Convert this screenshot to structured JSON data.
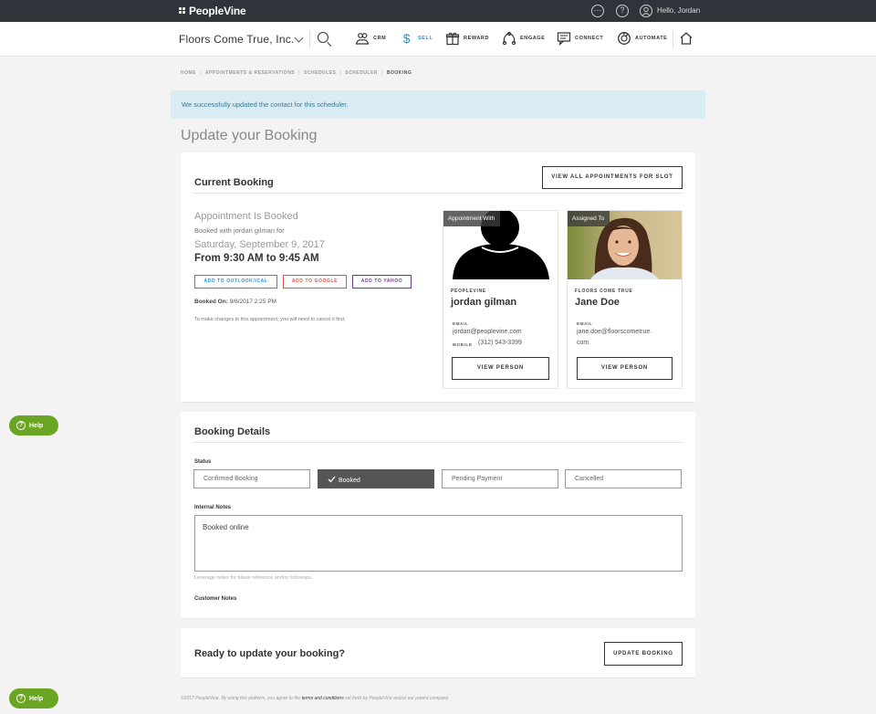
{
  "topbar": {
    "logo": "PeopleVine",
    "greeting": "Hello, Jordan",
    "icons": [
      "more-icon",
      "help-icon",
      "user-icon"
    ]
  },
  "nav": {
    "brand": "Floors Come True, Inc.",
    "items": [
      {
        "label": "CRM",
        "icon": "crm-icon"
      },
      {
        "label": "SELL",
        "icon": "dollar-icon",
        "active": true
      },
      {
        "label": "REWARD",
        "icon": "gift-icon"
      },
      {
        "label": "ENGAGE",
        "icon": "engage-icon"
      },
      {
        "label": "CONNECT",
        "icon": "chat-icon"
      },
      {
        "label": "AUTOMATE",
        "icon": "automate-icon"
      }
    ]
  },
  "breadcrumb": [
    "HOME",
    "APPOINTMENTS & RESERVATIONS",
    "SCHEDULES",
    "SCHEDULER",
    "BOOKING"
  ],
  "alert": "We successfully updated the contact for this scheduler.",
  "page_title": "Update your Booking",
  "current_booking": {
    "title": "Current Booking",
    "view_all_button": "VIEW ALL APPOINTMENTS FOR SLOT",
    "status": "Appointment Is Booked",
    "booked_with": "Booked with jordan gilman for",
    "date": "Saturday, September 9, 2017",
    "time": "From 9:30 AM to 9:45 AM",
    "calendar_buttons": [
      "ADD TO OUTLOOK/ICAL",
      "ADD TO GOOGLE",
      "ADD TO YAHOO"
    ],
    "calendar_colors": [
      "#2e8fc9",
      "#d9534f",
      "#6f3a8a"
    ],
    "booked_on_label": "Booked On:",
    "booked_on_value": "9/6/2017 2:25 PM",
    "cancel_note": "To make changes to this appointment, you will need to cancel it first.",
    "appointment_with": {
      "tag": "Appointment With",
      "org": "PEOPLEVINE",
      "name": "jordan gilman",
      "email_label": "EMAIL",
      "email": "jordan@peoplevine.com",
      "mobile_label": "MOBILE",
      "mobile": "(312) 543-3399",
      "button": "VIEW PERSON"
    },
    "assigned_to": {
      "tag": "Assigned To",
      "org": "FLOORS COME TRUE",
      "name": "Jane Doe",
      "email_label": "EMAIL",
      "email_line1": "jane.doe@floorscometrue.",
      "email_line2": "com",
      "button": "VIEW PERSON"
    }
  },
  "booking_details": {
    "title": "Booking Details",
    "status_label": "Status",
    "statuses": [
      "Confirmed Booking",
      "Booked",
      "Pending Payment",
      "Cancelled"
    ],
    "selected_status": "Booked",
    "internal_notes_label": "Internal Notes",
    "internal_notes_value": "Booked online",
    "notes_help": "Leverage notes for future reference and/or followups.",
    "customer_notes_label": "Customer Notes"
  },
  "update": {
    "prompt": "Ready to update your booking?",
    "button": "UPDATE BOOKING"
  },
  "footer": {
    "prefix": "©2017 PeopleVine. By using this platform, you agree to the",
    "link": "terms and conditions",
    "suffix": "set forth by PeopleVine and/or our parent company."
  },
  "help_label": "Help",
  "colors": {
    "accent": "#2e8fc9",
    "help": "#6aa524",
    "topbar": "#2f343a"
  }
}
